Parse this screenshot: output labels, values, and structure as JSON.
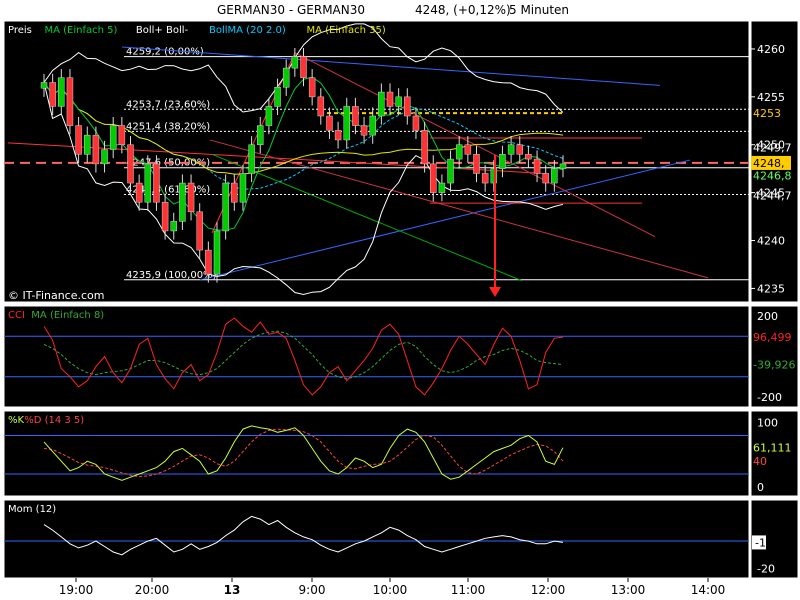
{
  "header": {
    "instrument": "GERMAN30 - GERMAN30",
    "price": "4248, (+0,12%)",
    "timeframe": "5 Minuten"
  },
  "colors": {
    "background": "#000000",
    "frame": "#ffffff",
    "candle_up": "#00cc00",
    "candle_down": "#ff3333",
    "ma5": "#00cc33",
    "ma35": "#e6e600",
    "bollinger": "#ffffff",
    "fib_line": "#ffffff",
    "fib_gold": "#ffcc00",
    "blue": "#3366ff",
    "red_line": "#ff3333",
    "green_line": "#00aa00",
    "cci": "#ff2222",
    "cci_ma": "#33aa33",
    "stoch_k": "#ccff33",
    "stoch_d": "#ff4444",
    "momentum": "#ffffff"
  },
  "chart_data": {
    "type": "line",
    "time_axis": [
      "19:00",
      "20:00",
      "13",
      "9:00",
      "10:00",
      "11:00",
      "12:00",
      "13:00",
      "14:00"
    ],
    "price_panel": {
      "legend": [
        {
          "label": "Preis",
          "color": "#ffffff"
        },
        {
          "label": "MA (Einfach 5)",
          "color": "#00cc33"
        },
        {
          "label": "Boll+ Boll-",
          "color": "#ffffff"
        },
        {
          "label": "BollMA (20 2.0)",
          "color": "#00ccff"
        },
        {
          "label": "MA (Einfach 35)",
          "color": "#e6e600"
        }
      ],
      "ylim": [
        4234,
        4262.5
      ],
      "y_ticks": [
        4235,
        4240,
        4245,
        4250,
        4255,
        4260
      ],
      "fib_levels": [
        {
          "price": 4259.2,
          "label": "4259,2 (0,00%)"
        },
        {
          "price": 4253.7,
          "label": "4253,7 (23,60%)"
        },
        {
          "price": 4251.4,
          "label": "4251,4 (38,20%)"
        },
        {
          "price": 4247.6,
          "label": "4247,6 (50,00%)"
        },
        {
          "price": 4244.8,
          "label": "4244,8 (61,80%)"
        },
        {
          "price": 4235.9,
          "label": "4235,9 (100,00%)"
        }
      ],
      "price_tags": [
        {
          "text": "4253",
          "price": 4253.3,
          "style": "gold-text"
        },
        {
          "text": "4249,7",
          "price": 4249.7,
          "style": "white-text"
        },
        {
          "text": "4248,",
          "price": 4248.1,
          "style": "gold-box"
        },
        {
          "text": "4246,8",
          "price": 4246.8,
          "style": "green-text"
        },
        {
          "text": "4244,7",
          "price": 4244.7,
          "style": "white-text"
        }
      ],
      "closes": [
        4256.5,
        4254,
        4257,
        4252,
        4249,
        4251,
        4248,
        4249.5,
        4252,
        4250,
        4246,
        4244,
        4248,
        4244,
        4241,
        4242,
        4246,
        4243,
        4239,
        4236.5,
        4241,
        4246,
        4244,
        4247,
        4250,
        4252,
        4254,
        4256,
        4258,
        4259.2,
        4257,
        4255,
        4253,
        4251.5,
        4250.5,
        4254,
        4252,
        4251,
        4253,
        4255.5,
        4254,
        4255,
        4253,
        4251.5,
        4248,
        4245,
        4246,
        4248.5,
        4250,
        4249,
        4247,
        4246,
        4247.5,
        4249,
        4250,
        4249,
        4248.5,
        4247,
        4246,
        4247.5,
        4248
      ]
    },
    "cci_panel": {
      "legend": [
        {
          "label": "CCI",
          "color": "#ff2222"
        },
        {
          "label": "MA (Einfach 8)",
          "color": "#33aa33"
        }
      ],
      "ylim": [
        -230,
        230
      ],
      "y_ticks": [
        -200,
        200
      ],
      "ref_lines": [
        100,
        -100
      ],
      "tags": [
        {
          "text": "96,499",
          "value": 96.499,
          "color": "#ff2222"
        },
        {
          "text": "-39,926",
          "value": -39.926,
          "color": "#33aa33"
        }
      ],
      "cci": [
        150,
        80,
        -60,
        -100,
        -150,
        -120,
        -50,
        0,
        -80,
        -130,
        -60,
        60,
        90,
        -40,
        -110,
        -160,
        -80,
        -40,
        -120,
        -90,
        20,
        160,
        190,
        150,
        120,
        170,
        110,
        120,
        90,
        -20,
        -140,
        -190,
        -150,
        -80,
        -50,
        -120,
        -70,
        -20,
        40,
        130,
        160,
        110,
        -20,
        -150,
        -190,
        -130,
        -60,
        30,
        100,
        60,
        10,
        -40,
        60,
        140,
        100,
        -20,
        -160,
        -140,
        20,
        90,
        96.5
      ],
      "ma": [
        60,
        40,
        10,
        -30,
        -60,
        -80,
        -90,
        -80,
        -75,
        -70,
        -60,
        -40,
        -20,
        -20,
        -30,
        -50,
        -70,
        -85,
        -90,
        -80,
        -60,
        -20,
        20,
        60,
        90,
        110,
        120,
        125,
        115,
        90,
        50,
        10,
        -40,
        -80,
        -100,
        -110,
        -100,
        -80,
        -50,
        -10,
        30,
        60,
        70,
        50,
        0,
        -40,
        -70,
        -80,
        -70,
        -50,
        -20,
        0,
        10,
        30,
        40,
        30,
        10,
        -20,
        -30,
        -35,
        -39.9
      ]
    },
    "stoch_panel": {
      "legend": [
        {
          "label": "%K",
          "color": "#ccff33"
        },
        {
          "label": "%D (14 3 5)",
          "color": "#ff4444"
        }
      ],
      "ylim": [
        -8,
        112
      ],
      "y_ticks": [
        0,
        100
      ],
      "ref_lines": [
        80,
        20
      ],
      "tags": [
        {
          "text": "61,111",
          "value": 61.111,
          "color": "#ccff33"
        },
        {
          "text": "40",
          "value": 40,
          "color": "#ff4444"
        }
      ],
      "k": [
        70,
        55,
        40,
        25,
        30,
        40,
        35,
        20,
        15,
        10,
        15,
        20,
        25,
        30,
        40,
        55,
        60,
        50,
        40,
        20,
        25,
        45,
        70,
        90,
        95,
        92,
        90,
        85,
        88,
        92,
        80,
        60,
        40,
        25,
        20,
        30,
        45,
        40,
        30,
        35,
        60,
        80,
        90,
        85,
        70,
        45,
        20,
        12,
        15,
        25,
        35,
        45,
        55,
        60,
        65,
        75,
        80,
        70,
        40,
        35,
        61.1
      ],
      "d": [
        60,
        58,
        52,
        45,
        38,
        34,
        32,
        30,
        26,
        22,
        18,
        16,
        17,
        20,
        25,
        32,
        40,
        48,
        50,
        45,
        36,
        32,
        40,
        55,
        70,
        82,
        88,
        90,
        89,
        88,
        86,
        80,
        70,
        55,
        40,
        30,
        28,
        32,
        35,
        36,
        40,
        50,
        62,
        74,
        80,
        78,
        65,
        48,
        32,
        22,
        20,
        26,
        34,
        42,
        50,
        56,
        62,
        66,
        64,
        55,
        40
      ]
    },
    "mom_panel": {
      "legend": [
        {
          "label": "Mom (12)",
          "color": "#ffffff"
        }
      ],
      "ylim": [
        -24,
        27
      ],
      "y_ticks": [
        -20
      ],
      "ref_lines": [
        0
      ],
      "tags": [
        {
          "text": "-1",
          "value": -1,
          "color": "#ffffff"
        }
      ],
      "mom": [
        12,
        8,
        3,
        -2,
        -5,
        -3,
        0,
        -4,
        -8,
        -10,
        -6,
        -3,
        0,
        2,
        -3,
        -8,
        -6,
        -2,
        -6,
        -4,
        -1,
        4,
        8,
        14,
        18,
        16,
        12,
        15,
        10,
        6,
        3,
        1,
        -3,
        -6,
        -8,
        -5,
        -2,
        0,
        3,
        6,
        10,
        8,
        4,
        1,
        -4,
        -6,
        -8,
        -6,
        -4,
        -2,
        0,
        2,
        3,
        4,
        3,
        1,
        0,
        -2,
        -2,
        0,
        -1
      ]
    }
  },
  "footer": {
    "copyright": "© IT-Finance.com"
  }
}
